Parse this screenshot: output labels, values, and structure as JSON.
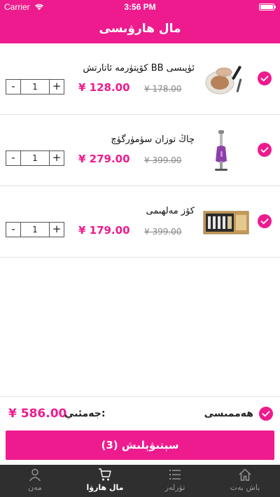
{
  "status_bar": {
    "carrier": "Carrier",
    "time": "3:56 PM"
  },
  "header": {
    "title": "مال ھارۋىسى"
  },
  "items": [
    {
      "name": "ئۈپىسى BB كۆپتۈرمە ئاتارتش",
      "price": "¥ 128.00",
      "old_price": "¥ 178.00",
      "quantity": "1",
      "selected": true,
      "thumb_icon": "cushion-compact-icon"
    },
    {
      "name": "چاڭ توزان سۈمۈرگۈچ",
      "price": "¥ 279.00",
      "old_price": "¥ 399.00",
      "quantity": "1",
      "selected": true,
      "thumb_icon": "vacuum-cleaner-icon"
    },
    {
      "name": "كۆز مەلھىمى",
      "price": "¥ 179.00",
      "old_price": "¥ 399.00",
      "quantity": "1",
      "selected": true,
      "thumb_icon": "eye-cream-box-icon"
    }
  ],
  "stepper": {
    "minus": "-",
    "plus": "+"
  },
  "footer": {
    "total_label": "جەمئىي:",
    "total_price": "¥ 586.00",
    "select_all_label": "ھەممىسى",
    "checkout_label": "سېتىۋېلىش (3)"
  },
  "tabbar": {
    "tabs": [
      {
        "label": "مەن",
        "icon": "person-icon",
        "active": false
      },
      {
        "label": "مال ھارۋا",
        "icon": "cart-icon",
        "active": true
      },
      {
        "label": "تۈرلەر",
        "icon": "list-icon",
        "active": false
      },
      {
        "label": "باش بەت",
        "icon": "home-icon",
        "active": false
      }
    ]
  },
  "colors": {
    "accent": "#ee1b8e",
    "tabbar_bg": "#2f2f2f"
  }
}
